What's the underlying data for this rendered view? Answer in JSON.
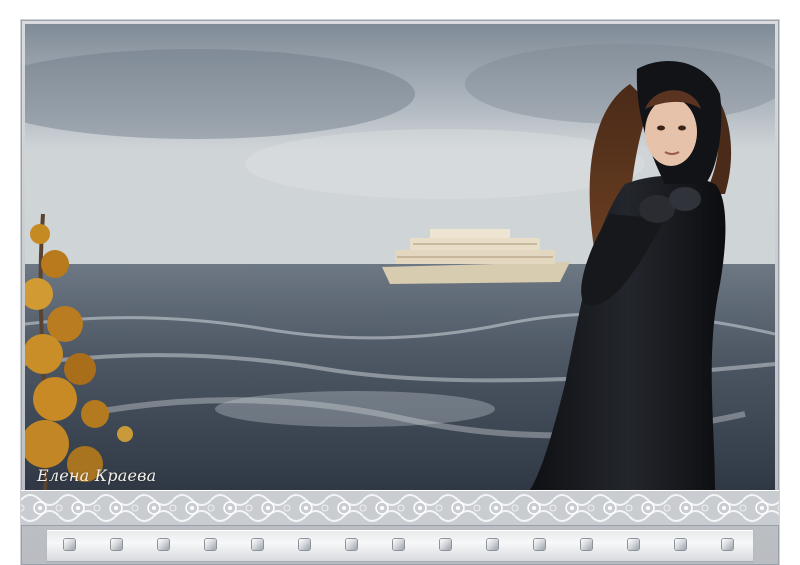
{
  "image": {
    "signature_text": "Елена Краева",
    "scene": [
      "stormy-sea",
      "ship",
      "woman-in-black-coat",
      "autumn-tree",
      "lace-border"
    ],
    "studs_count": 15,
    "colors": {
      "sky": "#a9b3bb",
      "sea": "#4d5662",
      "coat": "#15171b",
      "hair": "#5a3420",
      "leaves": "#c58a22",
      "frame": "#c5c8cc"
    }
  }
}
